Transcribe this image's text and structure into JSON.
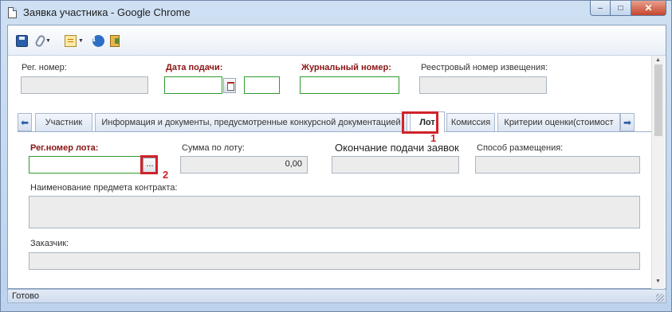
{
  "window": {
    "title": "Заявка участника - Google Chrome"
  },
  "toolbar": {
    "icons": [
      "save-icon",
      "attach-icon",
      "document-icon",
      "info-icon",
      "exit-icon"
    ]
  },
  "header": {
    "reg_number": {
      "label": "Рег. номер:",
      "value": ""
    },
    "submit_date": {
      "label": "Дата подачи:",
      "value": "",
      "time": ""
    },
    "journal_number": {
      "label": "Журнальный номер:",
      "value": ""
    },
    "registry_notice_number": {
      "label": "Реестровый номер извещения:",
      "value": ""
    }
  },
  "tabs": [
    {
      "label": "Участник"
    },
    {
      "label": "Информация и документы, предусмотренные конкурсной документацией"
    },
    {
      "label": "Лот"
    },
    {
      "label": "Комиссия"
    },
    {
      "label": "Критерии оценки(стоимост"
    }
  ],
  "annotations": {
    "marker1": "1",
    "marker2": "2"
  },
  "lot": {
    "reg_lot_number": {
      "label": "Рег.номер лота:",
      "value": "",
      "button": "..."
    },
    "lot_sum": {
      "label": "Сумма по лоту:",
      "value": "0,00"
    },
    "submission_end": {
      "label": "Окончание подачи заявок",
      "value": ""
    },
    "placement_method": {
      "label": "Способ размещения:",
      "value": ""
    },
    "contract_subject": {
      "label": "Наименование предмета контракта:",
      "value": ""
    },
    "customer": {
      "label": "Заказчик:",
      "value": ""
    }
  },
  "status": {
    "text": "Готово"
  }
}
